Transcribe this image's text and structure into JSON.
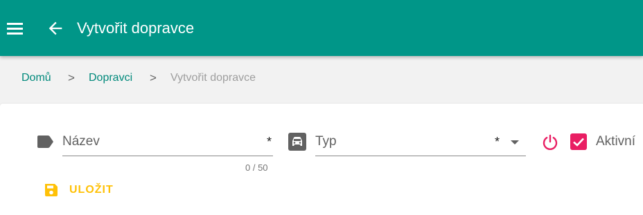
{
  "header": {
    "title": "Vytvořit dopravce",
    "menu_icon": "menu-icon",
    "back_icon": "arrow-back-icon",
    "background_color": "#009688"
  },
  "breadcrumb": {
    "items": [
      {
        "label": "Domů"
      },
      {
        "label": "Dopravci"
      }
    ],
    "separator": ">",
    "current": "Vytvořit dopravce"
  },
  "form": {
    "name_field": {
      "label": "Název",
      "required_marker": "*",
      "value": "",
      "counter": "0 / 50",
      "icon": "label-icon"
    },
    "type_field": {
      "label": "Typ",
      "required_marker": "*",
      "value": "",
      "icon": "car-icon"
    },
    "active": {
      "label": "Aktivní",
      "checked": true,
      "icon": "power-icon",
      "checkbox_color": "#e91e63"
    },
    "save_button": {
      "label": "ULOŽIT",
      "icon": "save-icon",
      "color": "#ffc107"
    }
  }
}
